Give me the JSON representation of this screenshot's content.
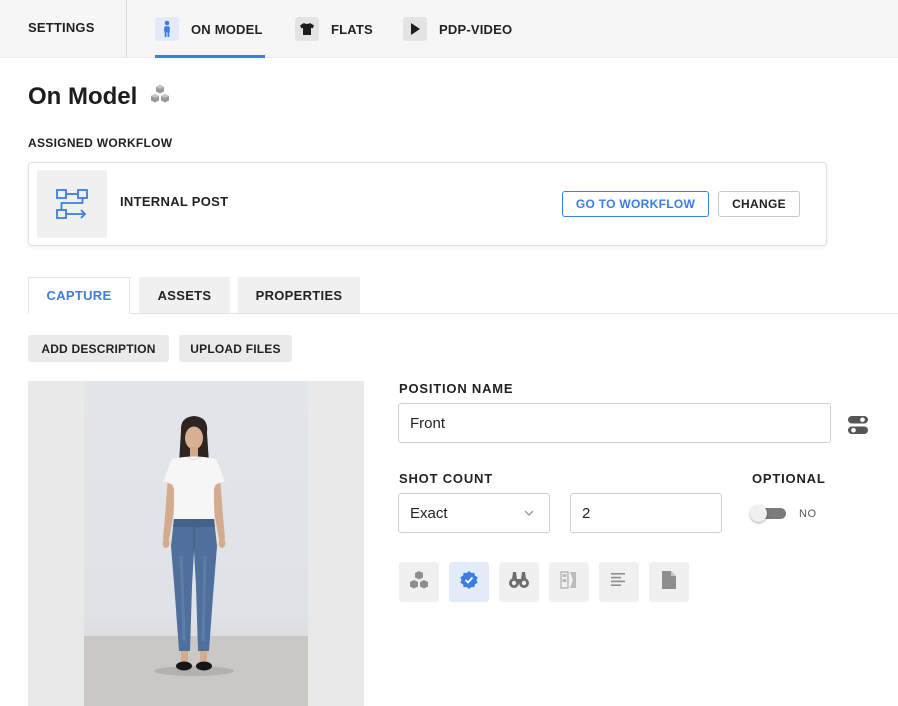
{
  "nav": {
    "settings_label": "SETTINGS",
    "tabs": [
      {
        "label": "ON MODEL",
        "icon": "person-icon",
        "active": true
      },
      {
        "label": "FLATS",
        "icon": "tshirt-icon",
        "active": false
      },
      {
        "label": "PDP-VIDEO",
        "icon": "play-icon",
        "active": false
      }
    ]
  },
  "page": {
    "title": "On Model",
    "title_icon": "boxes-icon",
    "assigned_workflow_label": "ASSIGNED WORKFLOW"
  },
  "workflow": {
    "name": "INTERNAL POST",
    "icon": "workflow-icon",
    "go_to_label": "GO TO WORKFLOW",
    "change_label": "CHANGE"
  },
  "subtabs": [
    {
      "label": "CAPTURE",
      "active": true
    },
    {
      "label": "ASSETS",
      "active": false
    },
    {
      "label": "PROPERTIES",
      "active": false
    }
  ],
  "actions": {
    "add_description": "ADD DESCRIPTION",
    "upload_files": "UPLOAD FILES"
  },
  "form": {
    "position_name_label": "POSITION NAME",
    "position_name_value": "Front",
    "shot_count_label": "SHOT COUNT",
    "shot_count_mode": "Exact",
    "shot_count_value": "2",
    "optional_label": "OPTIONAL",
    "optional_state": "NO"
  },
  "icon_row": [
    "boxes-icon",
    "verified-badge-icon",
    "binoculars-icon",
    "compare-icon",
    "text-align-icon",
    "document-icon"
  ],
  "colors": {
    "accent": "#3b7de1",
    "accent_bg": "#e4ebf8"
  }
}
